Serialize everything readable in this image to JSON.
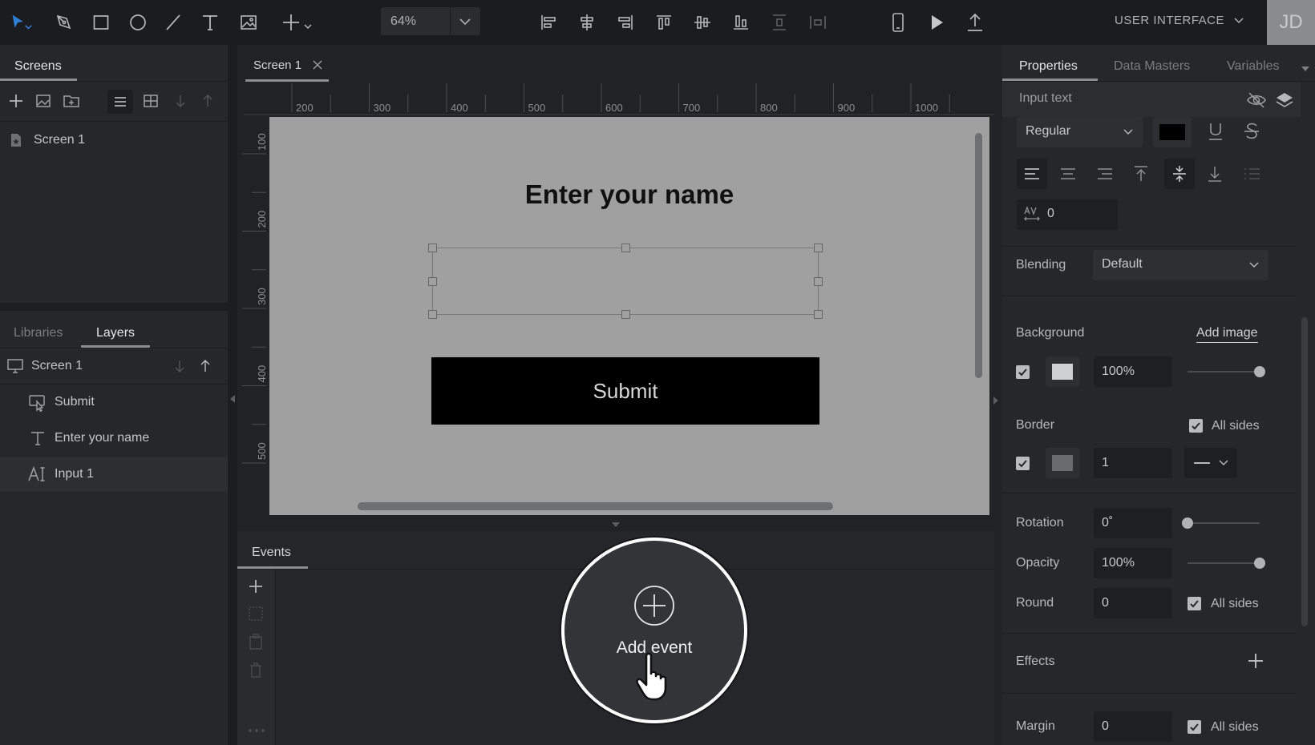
{
  "toolbar": {
    "zoom_value": "64%",
    "menu_label": "USER INTERFACE",
    "avatar_initials": "JD"
  },
  "left_panel": {
    "screens_tab": "Screens",
    "screens_list": [
      "Screen 1"
    ],
    "libraries_tab": "Libraries",
    "layers_tab": "Layers",
    "layers_root": "Screen 1",
    "layers": [
      "Submit",
      "Enter your name",
      "Input 1"
    ]
  },
  "canvas": {
    "doc_tab": "Screen 1",
    "ruler_top": [
      "200",
      "300",
      "400",
      "500",
      "600",
      "700",
      "800",
      "900",
      "1000"
    ],
    "ruler_left": [
      "100",
      "200",
      "300",
      "400",
      "500"
    ],
    "artboard": {
      "heading": "Enter your name",
      "button_label": "Submit"
    }
  },
  "events_panel": {
    "tab": "Events",
    "add_event": "Add event"
  },
  "right_panel": {
    "tabs": [
      "Properties",
      "Data Masters",
      "Variables"
    ],
    "selection_label": "Input text",
    "font_weight": "Regular",
    "letter_spacing": "0",
    "blending_label": "Blending",
    "blending_value": "Default",
    "background_label": "Background",
    "add_image": "Add image",
    "background_opacity": "100%",
    "background_opacity_level": 1.0,
    "border_label": "Border",
    "border_all_sides": "All sides",
    "border_width": "1",
    "rotation_label": "Rotation",
    "rotation_value": "0˚",
    "rotation_level": 0.0,
    "opacity_label": "Opacity",
    "opacity_value": "100%",
    "opacity_level": 1.0,
    "round_label": "Round",
    "round_value": "0",
    "round_all_sides": "All sides",
    "effects_label": "Effects",
    "margin_label": "Margin",
    "margin_value": "0",
    "margin_all_sides": "All sides"
  },
  "colors": {
    "accent": "#2f7fd6",
    "panel_bg": "#26272b",
    "artboard_bg": "#a0a0a0",
    "button_bg": "#000000",
    "text_color_swatch": "#000000",
    "background_swatch": "#cfd0d1",
    "border_swatch": "#6a6b6e"
  }
}
